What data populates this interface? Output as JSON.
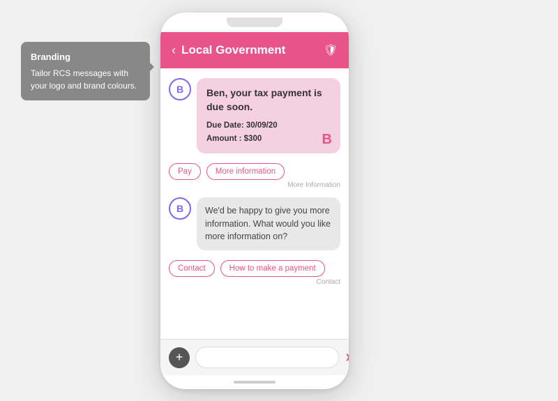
{
  "tooltip": {
    "title": "Branding",
    "body": "Tailor RCS messages with your logo and brand colours."
  },
  "phone": {
    "header": {
      "back_label": "‹",
      "title": "Local Government",
      "shield": "🛡"
    },
    "messages": [
      {
        "avatar": "B",
        "type": "tax_card",
        "title": "Ben, your tax payment is due soon.",
        "due_date_label": "Due Date:",
        "due_date": "30/09/20",
        "amount_label": "Amount",
        "amount": ": $300",
        "brand_letter": "B"
      },
      {
        "type": "buttons",
        "buttons": [
          "Pay",
          "More information"
        ],
        "label": "More Information"
      },
      {
        "avatar": "B",
        "type": "info_bubble",
        "text": "We'd be happy to give you more information. What would you like more information on?"
      },
      {
        "type": "buttons",
        "buttons": [
          "Contact",
          "How to make a payment"
        ],
        "label": "Contact"
      }
    ],
    "input": {
      "placeholder": "",
      "add_label": "+",
      "send_label": "➤"
    }
  }
}
